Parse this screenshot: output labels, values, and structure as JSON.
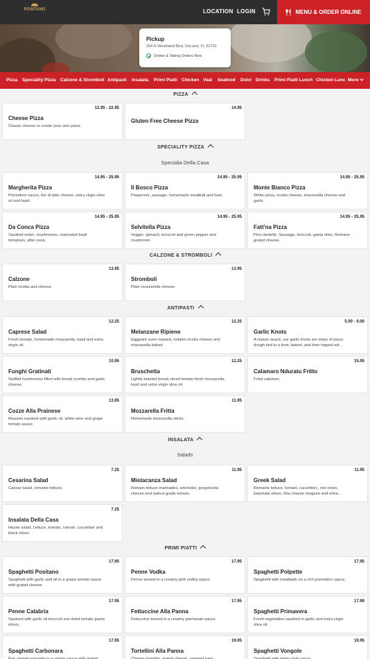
{
  "header": {
    "logo_text": "POSITANO",
    "location_label": "LOCATION",
    "login_label": "LOGIN",
    "order_label": "MENU & ORDER ONLINE"
  },
  "pickup": {
    "title": "Pickup",
    "address": "204 N Woodland Blvd, DeLand, FL 32720",
    "status": "Online & Taking Orders Now"
  },
  "categories": [
    "Pizza",
    "Speciality Pizza",
    "Calzone & Stromboli",
    "Antipasti",
    "Insalata",
    "Primi Piatti",
    "Chicken",
    "Veal",
    "Seafood",
    "Dolci",
    "Drinks",
    "Primi Piatti Lunch",
    "Chicken Lunc"
  ],
  "more_label": "More",
  "sections": {
    "pizza": {
      "title": "PIZZA",
      "items": [
        {
          "name": "Cheese Pizza",
          "price": "12.95 - 22.95",
          "desc": "Classic cheese or create your own pizza."
        },
        {
          "name": "Gluten Free Cheese Pizza",
          "price": "14.95",
          "desc": ""
        }
      ]
    },
    "speciality": {
      "title": "SPECIALITY PIZZA",
      "subtitle": "Specialia Della Casa",
      "items": [
        {
          "name": "Margherita Pizza",
          "price": "14.95 - 25.95",
          "desc": "Pomodoro sauce, fior di latte cheese, extra virgin olive oil and basil."
        },
        {
          "name": "Il Bosco Pizza",
          "price": "14.95 - 25.95",
          "desc": "Pepperoni, sausage, homemade meatball and ham."
        },
        {
          "name": "Monte Bianco Pizza",
          "price": "14.95 - 25.95",
          "desc": "White pizza, ricotta cheese, mozzarella cheese and garlic."
        },
        {
          "name": "Da Conca Pizza",
          "price": "14.95 - 25.95",
          "desc": "Sautéed onion, mushrooms, marinated basil tomatoes, after cook."
        },
        {
          "name": "Selvitella Pizza",
          "price": "14.95 - 25.95",
          "desc": "Veggie, spinach, broccoli and green pepper and mushroom."
        },
        {
          "name": "Fatt'na Pizza",
          "price": "14.95 - 25.95",
          "desc": "Pino danielle. Sausage, broccoli, gaeta olive, Romano grated cheese."
        }
      ]
    },
    "calzone": {
      "title": "CALZONE & STROMBOLI",
      "items": [
        {
          "name": "Calzone",
          "price": "13.95",
          "desc": "Plain ricotta and cheese."
        },
        {
          "name": "Stromboli",
          "price": "13.95",
          "desc": "Plain mozzarella cheese."
        }
      ]
    },
    "antipasti": {
      "title": "ANTIPASTI",
      "items": [
        {
          "name": "Caprese Salad",
          "price": "12.25",
          "desc": "Fresh tomato, homemade mozzarella, basil and extra virgin oil."
        },
        {
          "name": "Melanzane Ripiene",
          "price": "12.25",
          "desc": "Eggplant oven roasted, rollatini ricotta cheese and mozzarella baked."
        },
        {
          "name": "Garlic Knots",
          "price": "5.00 - 9.00",
          "desc": "A classic snack, our garlic knots are strips of pizza dough tied in a knot, baked, and then topped wit..."
        },
        {
          "name": "Funghi Gratinati",
          "price": "10.95",
          "desc": "Stuffed mushrooms filled with bread crumbs and garlic cheese."
        },
        {
          "name": "Bruschetta",
          "price": "12.25",
          "desc": "Lightly toasted bread, diced tomato fresh mozzarella, basil and extra virgin olive oil."
        },
        {
          "name": "Calamaro Nduratu Fritto",
          "price": "15.95",
          "desc": "Fried calamari."
        },
        {
          "name": "Cozze Alla Prainese",
          "price": "13.95",
          "desc": "Mussels sautéed with garlic oil, white wine and grape tomato sauce."
        },
        {
          "name": "Mozzarella Fritta",
          "price": "11.95",
          "desc": "Homemade mozzarella sticks."
        }
      ]
    },
    "insalata": {
      "title": "INSALATA",
      "subtitle": "Salads",
      "items": [
        {
          "name": "Cesarina Salad",
          "price": "7.25",
          "desc": "Caesar salad, romaine lettuce."
        },
        {
          "name": "Mistacanza Salad",
          "price": "11.95",
          "desc": "Romain lettuce marinades, artichoke, gorgonzola cheese and walnut grade tomato."
        },
        {
          "name": "Greek Salad",
          "price": "11.95",
          "desc": "Romaine lettuce, tomato, cucumber,, red onion, kalamata olives, feta cheese oregano and extra..."
        },
        {
          "name": "Insalata Della Casa",
          "price": "7.25",
          "desc": "House salad. Lettuce, tomato, carrots, cucumber and black olives."
        }
      ]
    },
    "primi": {
      "title": "PRIMI PIATTI",
      "items": [
        {
          "name": "Spaghetti Positano",
          "price": "17.95",
          "desc": "Spaghetti with garlic and oil in a grape tomato sauce with grated cheese."
        },
        {
          "name": "Penne Vodka",
          "price": "17.95",
          "desc": "Penne tossed in a creamy pink vodka sauce."
        },
        {
          "name": "Spaghetti Polpette",
          "price": "17.95",
          "desc": "Spaghetti with meatballs on a rich pomodoro sauce."
        },
        {
          "name": "Penne Calabria",
          "price": "17.95",
          "desc": "Sauteed with garlic oil broccoli sun dried tomato gaeta olives."
        },
        {
          "name": "Fettuccine Alla Panna",
          "price": "17.95",
          "desc": "Fettuccine tossed in a creamy parmesan sauce."
        },
        {
          "name": "Spaghetti Primavera",
          "price": "17.99",
          "desc": "Fresh vegetables sautéed in garlic and extra virgin olive oil."
        },
        {
          "name": "Spaghetti Carbonara",
          "price": "17.95",
          "desc": "Pan seared pancetta in a cream sauce with grated"
        },
        {
          "name": "Tortellini Alla Panna",
          "price": "19.95",
          "desc": "Cheese tortellini, grated cheese, sauteed ham,"
        },
        {
          "name": "Spaghetti Vongole",
          "price": "19.95",
          "desc": "Spaghetti with white clam sauce."
        }
      ]
    }
  }
}
